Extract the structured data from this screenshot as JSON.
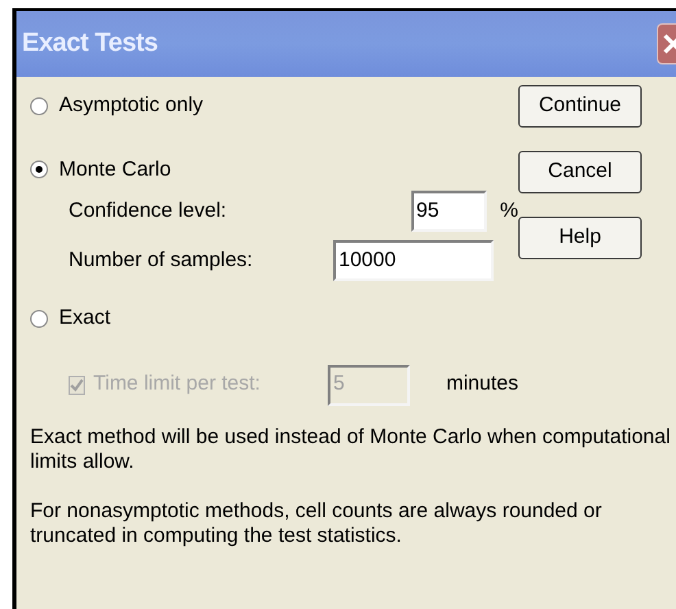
{
  "window": {
    "title": "Exact Tests"
  },
  "options": [
    {
      "label": "Asymptotic only",
      "selected": false
    },
    {
      "label": "Monte Carlo",
      "selected": true
    },
    {
      "label": "Exact",
      "selected": false
    }
  ],
  "monte_carlo": {
    "confidence_label": "Confidence level:",
    "confidence_value": "95",
    "confidence_unit": "%",
    "samples_label": "Number of samples:",
    "samples_value": "10000"
  },
  "exact": {
    "time_limit_label": "Time limit per test:",
    "time_limit_checked": true,
    "disabled": true,
    "time_limit_value": "5",
    "time_limit_unit": "minutes"
  },
  "buttons": [
    "Continue",
    "Cancel",
    "Help"
  ],
  "notes": [
    "Exact method will be used instead of Monte Carlo when computational limits allow.",
    "For nonasymptotic methods, cell counts are always rounded or truncated in computing the test statistics."
  ]
}
